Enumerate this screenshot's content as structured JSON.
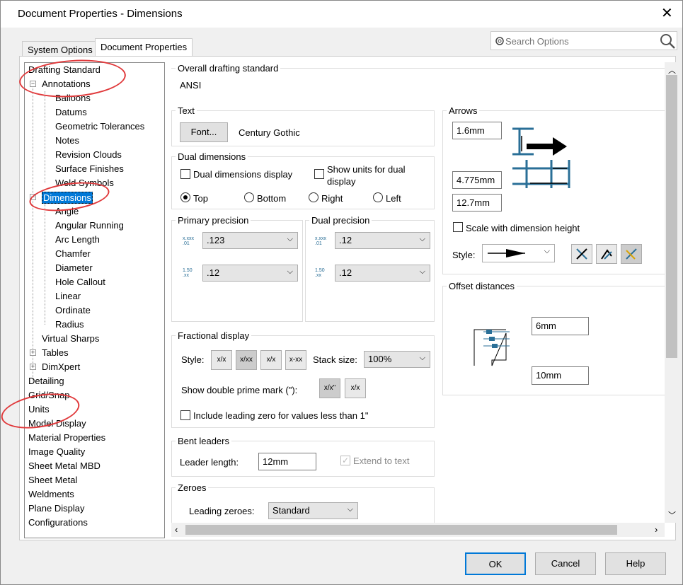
{
  "window": {
    "title": "Document Properties - Dimensions",
    "close_glyph": "✕"
  },
  "tabs": [
    {
      "label": "System Options"
    },
    {
      "label": "Document Properties"
    }
  ],
  "search": {
    "placeholder": "Search Options"
  },
  "tree": {
    "items": [
      "Drafting Standard",
      "Annotations",
      "Balloons",
      "Datums",
      "Geometric Tolerances",
      "Notes",
      "Revision Clouds",
      "Surface Finishes",
      "Weld Symbols",
      "Dimensions",
      "Angle",
      "Angular Running",
      "Arc Length",
      "Chamfer",
      "Diameter",
      "Hole Callout",
      "Linear",
      "Ordinate",
      "Radius",
      "Virtual Sharps",
      "Tables",
      "DimXpert",
      "Detailing",
      "Grid/Snap",
      "Units",
      "Model Display",
      "Material Properties",
      "Image Quality",
      "Sheet Metal MBD",
      "Sheet Metal",
      "Weldments",
      "Plane Display",
      "Configurations"
    ],
    "selected": "Dimensions"
  },
  "overall": {
    "title": "Overall drafting standard",
    "value": "ANSI"
  },
  "text": {
    "title": "Text",
    "font_button": "Font...",
    "font_name": "Century Gothic"
  },
  "dual": {
    "title": "Dual dimensions",
    "display_label": "Dual dimensions display",
    "show_units_label": "Show units for dual display",
    "radios": [
      "Top",
      "Bottom",
      "Right",
      "Left"
    ],
    "selected": "Top"
  },
  "primary": {
    "title": "Primary precision",
    "value1": ".123",
    "value2": ".12",
    "icon1": "x.xxx .01",
    "icon2": "1.50 .xx"
  },
  "dualprec": {
    "title": "Dual precision",
    "value1": ".12",
    "value2": ".12"
  },
  "fractional": {
    "title": "Fractional display",
    "style_label": "Style:",
    "stack_label": "Stack size:",
    "stack_value": "100%",
    "prime_label": "Show double prime mark (\"):",
    "leading_zero_label": "Include leading zero for values less than 1\"",
    "style_icons": [
      "x/x",
      "x/xx",
      "x/x",
      "x-xx"
    ],
    "prime_icons": [
      "x/x\"",
      "x/x"
    ]
  },
  "bent": {
    "title": "Bent leaders",
    "leader_label": "Leader length:",
    "leader_value": "12mm",
    "extend_label": "Extend to text"
  },
  "zeroes": {
    "title": "Zeroes",
    "leading_label": "Leading zeroes:",
    "leading_value": "Standard"
  },
  "arrows": {
    "title": "Arrows",
    "v1": "1.6mm",
    "v2": "4.775mm",
    "v3": "12.7mm",
    "scale_label": "Scale with dimension height",
    "style_label": "Style:"
  },
  "offset": {
    "title": "Offset distances",
    "v1": "6mm",
    "v2": "10mm"
  },
  "buttons": {
    "ok": "OK",
    "cancel": "Cancel",
    "help": "Help"
  },
  "colors": {
    "selection": "#0078d7",
    "annotation": "#e0393b",
    "diagram": "#2a6f97"
  }
}
